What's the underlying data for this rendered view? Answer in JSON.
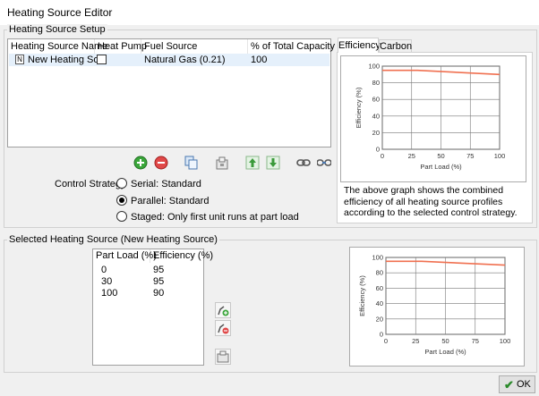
{
  "window": {
    "title": "Heating Source Editor"
  },
  "setup": {
    "group_label": "Heating Source Setup",
    "columns": [
      "Heating Source Name",
      "Heat Pump",
      "Fuel Source",
      "% of Total Capacity"
    ],
    "rows": [
      {
        "name": "New Heating So...",
        "heat_pump": false,
        "fuel": "Natural Gas  (0.21)",
        "capacity": "100"
      }
    ],
    "toolbar_icons": [
      "add-icon",
      "remove-icon",
      "copy-icon",
      "library-icon",
      "move-up-icon",
      "move-down-icon",
      "link-icon",
      "unlink-icon"
    ]
  },
  "control_strategy": {
    "label": "Control Strategy",
    "options": [
      "Serial: Standard",
      "Parallel: Standard",
      "Staged: Only first unit runs at part load"
    ],
    "selected": 1
  },
  "tabs": {
    "items": [
      "Efficiency",
      "Carbon"
    ],
    "active": 0
  },
  "combined_chart_note": "The above graph shows the combined efficiency of all heating source profiles according to the selected control strategy.",
  "selected_source": {
    "group_label": "Selected Heating Source (New Heating Source)",
    "columns": [
      "Part Load (%)",
      "Efficiency (%)"
    ],
    "rows": [
      [
        "0",
        "95"
      ],
      [
        "30",
        "95"
      ],
      [
        "100",
        "90"
      ]
    ],
    "button_icons": [
      "add-point-icon",
      "remove-point-icon",
      "library-icon"
    ]
  },
  "chart_data": [
    {
      "type": "line",
      "xlabel": "Part Load (%)",
      "ylabel": "Efficiency (%)",
      "xlim": [
        0,
        100
      ],
      "ylim": [
        0,
        100
      ],
      "xticks": [
        "0",
        "25",
        "50",
        "75",
        "100"
      ],
      "yticks": [
        "0",
        "20",
        "40",
        "60",
        "80",
        "100"
      ],
      "grid": true,
      "line_color": "#f07050",
      "series": [
        {
          "x": [
            0,
            30,
            100
          ],
          "y": [
            95,
            95,
            90
          ]
        }
      ]
    },
    {
      "type": "line",
      "xlabel": "Part Load (%)",
      "ylabel": "Efficiency (%)",
      "xlim": [
        0,
        100
      ],
      "ylim": [
        0,
        100
      ],
      "xticks": [
        "0",
        "25",
        "50",
        "75",
        "100"
      ],
      "yticks": [
        "0",
        "20",
        "40",
        "60",
        "80",
        "100"
      ],
      "grid": true,
      "line_color": "#f07050",
      "series": [
        {
          "x": [
            0,
            30,
            100
          ],
          "y": [
            95,
            95,
            90
          ]
        }
      ]
    }
  ],
  "ok_button": {
    "label": "OK"
  }
}
